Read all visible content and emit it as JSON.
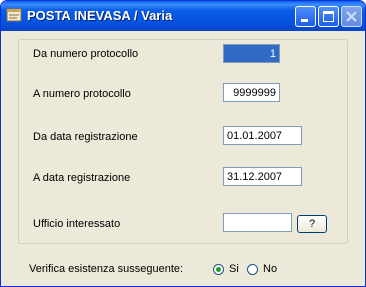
{
  "window": {
    "title": "POSTA INEVASA / Varia"
  },
  "form": {
    "da_numero_label": "Da numero protocollo",
    "da_numero_value": "1",
    "a_numero_label": "A  numero protocollo",
    "a_numero_value": "9999999",
    "da_data_label": "Da data registrazione",
    "da_data_value": "01.01.2007",
    "a_data_label": "A  data registrazione",
    "a_data_value": "31.12.2007",
    "ufficio_label": "Ufficio interessato",
    "ufficio_value": "",
    "help_button_label": "?"
  },
  "verifica": {
    "label": "Verifica esistenza susseguente:",
    "option_si": "Si",
    "option_no": "No",
    "selected": "Si"
  },
  "colors": {
    "titlebar": "#0553e1",
    "selection": "#316ac5",
    "window_bg": "#ece9d8"
  }
}
